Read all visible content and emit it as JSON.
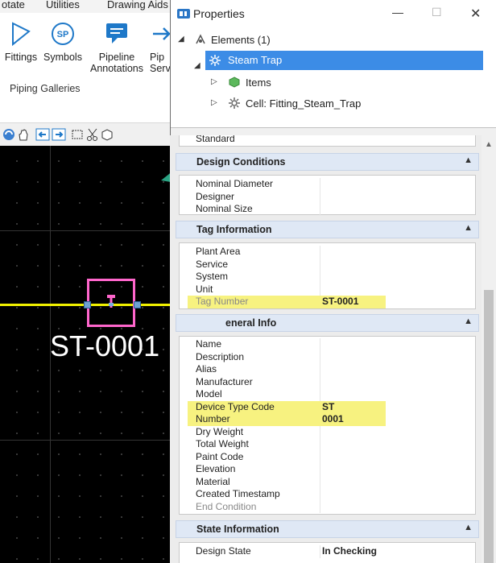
{
  "menubar": {
    "items": [
      "otate",
      "Utilities",
      "Drawing Aids"
    ]
  },
  "ribbon": {
    "buttons": [
      {
        "label": "Fittings"
      },
      {
        "label": "Symbols"
      },
      {
        "label": "Pipeline Annotations"
      },
      {
        "label": "Pip Serv"
      }
    ],
    "group_label": "Piping Galleries",
    "symbols_badge": "SP"
  },
  "canvas": {
    "tag_text": "ST-0001"
  },
  "properties": {
    "title": "Properties",
    "tree": {
      "root": "Elements (1)",
      "selected": "Steam Trap",
      "children": [
        "Items",
        "Cell: Fitting_Steam_Trap"
      ]
    },
    "top_cut_label": "Standard",
    "sections": [
      {
        "title": "Design Conditions",
        "rows": [
          {
            "key": "Nominal Diameter",
            "value": ""
          },
          {
            "key": "Designer",
            "value": ""
          },
          {
            "key": "Nominal Size",
            "value": ""
          }
        ]
      },
      {
        "title": "Tag Information",
        "rows": [
          {
            "key": "Plant Area",
            "value": ""
          },
          {
            "key": "Service",
            "value": ""
          },
          {
            "key": "System",
            "value": ""
          },
          {
            "key": "Unit",
            "value": ""
          },
          {
            "key": "Tag Number",
            "value": "ST-0001",
            "highlight": true
          }
        ]
      },
      {
        "title": "eneral Info",
        "rows": [
          {
            "key": "Name",
            "value": ""
          },
          {
            "key": "Description",
            "value": ""
          },
          {
            "key": "Alias",
            "value": ""
          },
          {
            "key": "Manufacturer",
            "value": ""
          },
          {
            "key": "Model",
            "value": ""
          },
          {
            "key": "Device Type Code",
            "value": "ST",
            "highlight": true
          },
          {
            "key": "Number",
            "value": "0001",
            "highlight": true
          },
          {
            "key": "Dry Weight",
            "value": ""
          },
          {
            "key": "Total Weight",
            "value": ""
          },
          {
            "key": "Paint Code",
            "value": ""
          },
          {
            "key": "Elevation",
            "value": ""
          },
          {
            "key": "Material",
            "value": ""
          },
          {
            "key": "Created Timestamp",
            "value": ""
          },
          {
            "key": "End Condition",
            "value": ""
          }
        ]
      },
      {
        "title": "State Information",
        "rows": [
          {
            "key": "Design State",
            "value": "In Checking"
          }
        ]
      }
    ]
  },
  "colors": {
    "accent": "#3c8ce6",
    "highlight": "#f7f280",
    "pipe": "#f0f000",
    "trap": "#ff66cc",
    "arrow": "#2aa383"
  }
}
